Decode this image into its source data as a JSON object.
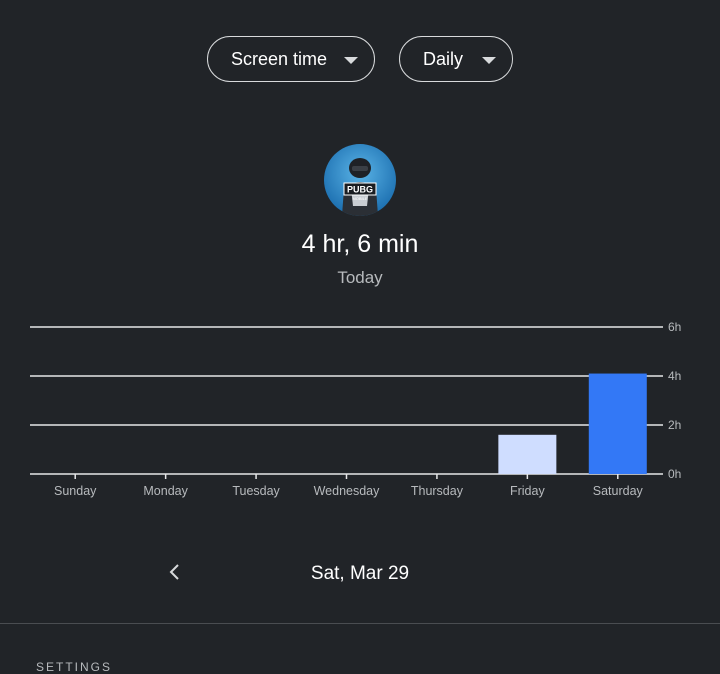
{
  "filters": {
    "metric": "Screen time",
    "period": "Daily"
  },
  "app": {
    "icon": "pubg-mobile-icon",
    "logo_text": "PUBG",
    "logo_subtext": "MOBILE"
  },
  "summary": {
    "total": "4 hr, 6 min",
    "day": "Today"
  },
  "chart_data": {
    "type": "bar",
    "categories": [
      "Sunday",
      "Monday",
      "Tuesday",
      "Wednesday",
      "Thursday",
      "Friday",
      "Saturday"
    ],
    "values": [
      0,
      0,
      0,
      0,
      0,
      1.6,
      4.1
    ],
    "unit": "h",
    "ylim": [
      0,
      6
    ],
    "y_ticks": [
      0,
      2,
      4,
      6
    ],
    "y_tick_labels": [
      "0h",
      "2h",
      "4h",
      "6h"
    ],
    "grid": true,
    "colors": {
      "bar": "#cfddff",
      "bar_selected": "#3378f6",
      "grid": "#e6e7e8",
      "label": "#b7babd"
    },
    "selected_index": 6
  },
  "navigation": {
    "prev_icon": "chevron-left-icon",
    "date": "Sat, Mar 29"
  },
  "settings": {
    "heading": "SETTINGS"
  }
}
